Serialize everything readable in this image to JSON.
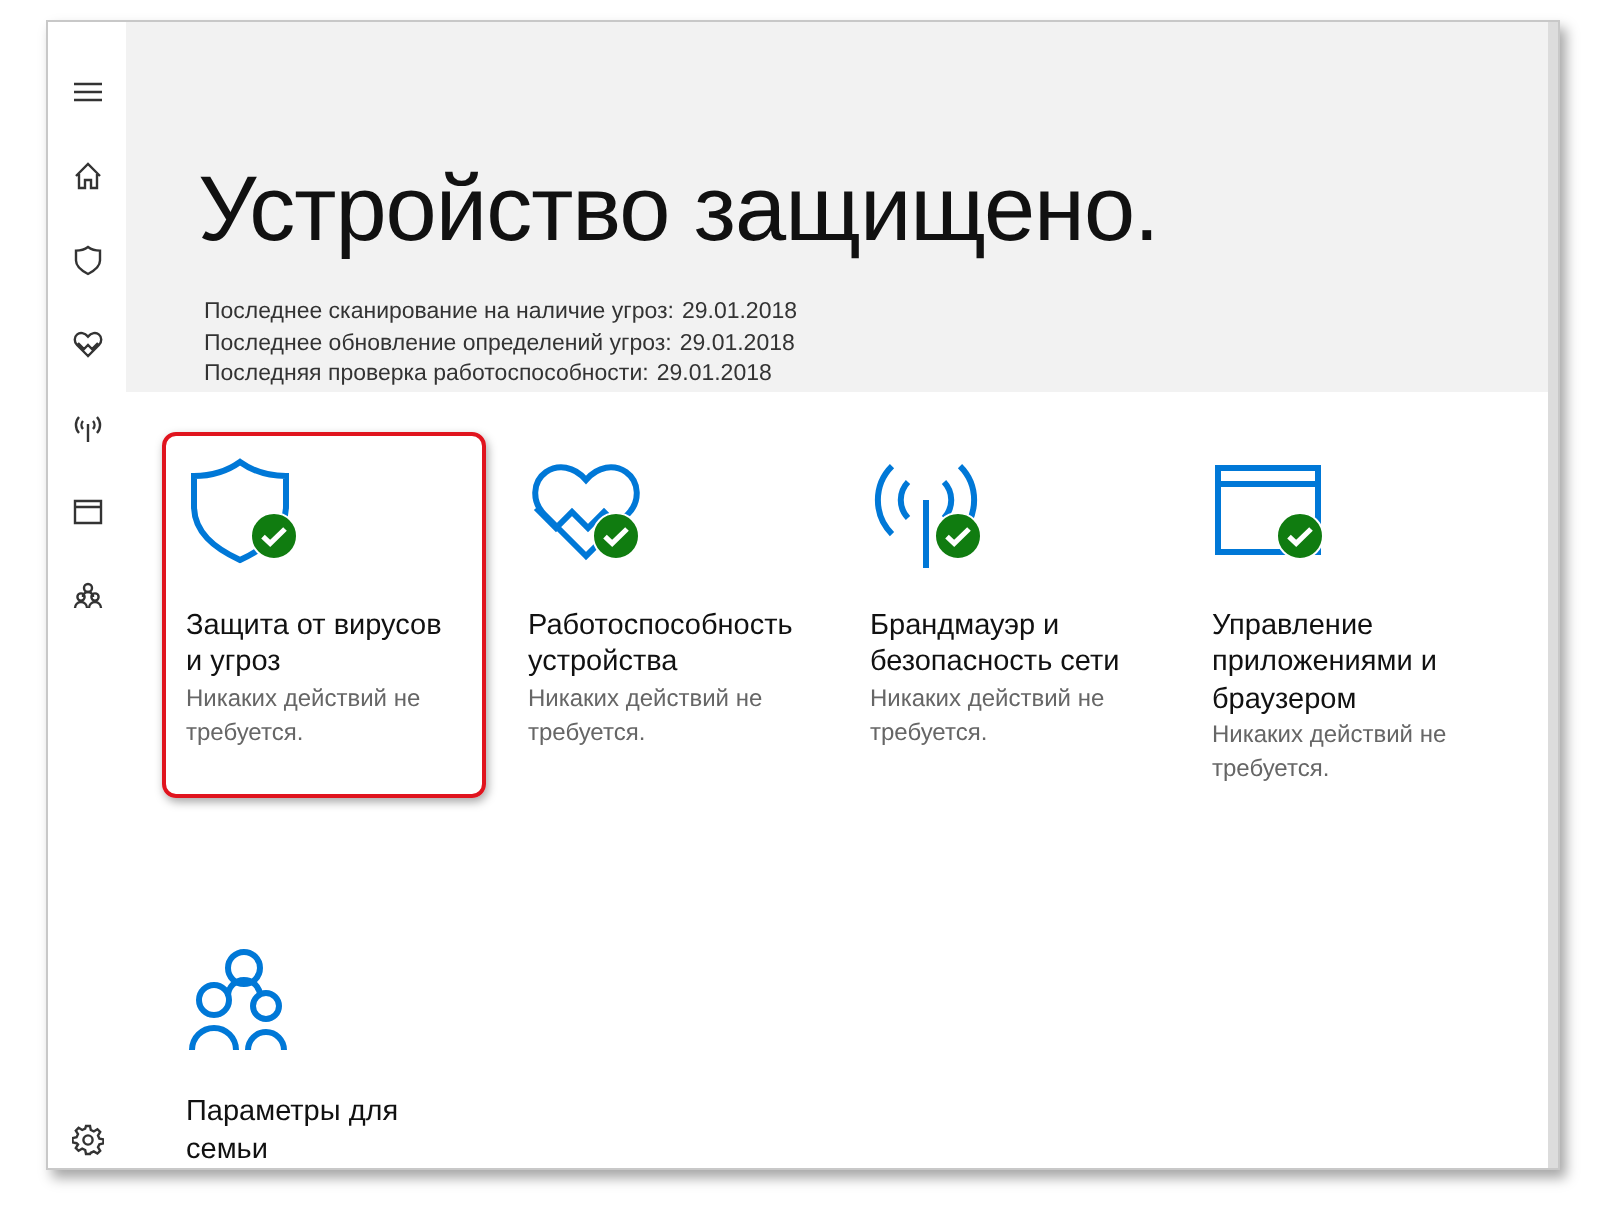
{
  "sidebar": {
    "items": [
      {
        "kind": "menu"
      },
      {
        "kind": "home"
      },
      {
        "kind": "shield"
      },
      {
        "kind": "heart"
      },
      {
        "kind": "antenna"
      },
      {
        "kind": "browser"
      },
      {
        "kind": "family"
      }
    ],
    "footer": [
      {
        "kind": "settings"
      }
    ]
  },
  "header": {
    "title": "Устройство защищено.",
    "stats": [
      {
        "label": "Последнее сканирование на наличие угроз:",
        "value": "29.01.2018"
      },
      {
        "label": "Последнее обновление определений угроз:",
        "value": "29.01.2018"
      },
      {
        "label": "Последняя проверка работоспособности:",
        "value": "29.01.2018"
      }
    ]
  },
  "tiles": [
    {
      "kind": "shield",
      "title": "Защита от вирусов и угроз",
      "status": "Никаких действий не требуется.",
      "ok": true,
      "highlighted": true
    },
    {
      "kind": "heart",
      "title": "Работоспособность устройства",
      "status": "Никаких действий не требуется.",
      "ok": true,
      "highlighted": false
    },
    {
      "kind": "antenna",
      "title": "Брандмауэр и безопасность сети",
      "status": "Никаких действий не требуется.",
      "ok": true,
      "highlighted": false
    },
    {
      "kind": "browser",
      "title": "Управление приложениями и браузером",
      "status": "Никаких действий не требуется.",
      "ok": true,
      "highlighted": false
    },
    {
      "kind": "family",
      "title": "Параметры для семьи",
      "ok": false,
      "highlighted": false
    }
  ]
}
